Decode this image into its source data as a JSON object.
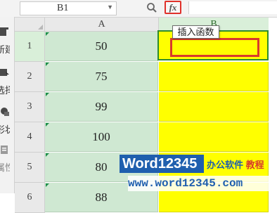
{
  "formula_bar": {
    "name_box": "B1",
    "fx_label": "fx"
  },
  "left_panel": {
    "items": [
      {
        "label": "新建",
        "icon": "new-icon"
      },
      {
        "label": "选择",
        "icon": "select-icon"
      },
      {
        "label": "形状",
        "icon": "shape-icon"
      },
      {
        "label": "属性",
        "icon": "property-icon"
      }
    ]
  },
  "sheet": {
    "columns": [
      "A",
      "B"
    ],
    "selected_column": "B",
    "rows": [
      {
        "num": "1",
        "a": "50"
      },
      {
        "num": "2",
        "a": "75"
      },
      {
        "num": "3",
        "a": "99"
      },
      {
        "num": "4",
        "a": "100"
      },
      {
        "num": "5",
        "a": "80"
      },
      {
        "num": "6",
        "a": "88"
      }
    ],
    "active_cell": "B1",
    "cell_b_color": "#ffff00",
    "cell_a_color": "#cfe8d2"
  },
  "tooltip": {
    "text": "插入函数"
  },
  "watermark": {
    "brand": "Word12345",
    "tagline_part1": "办公软件",
    "tagline_part2": "教程",
    "url": "www.word12345.com"
  }
}
